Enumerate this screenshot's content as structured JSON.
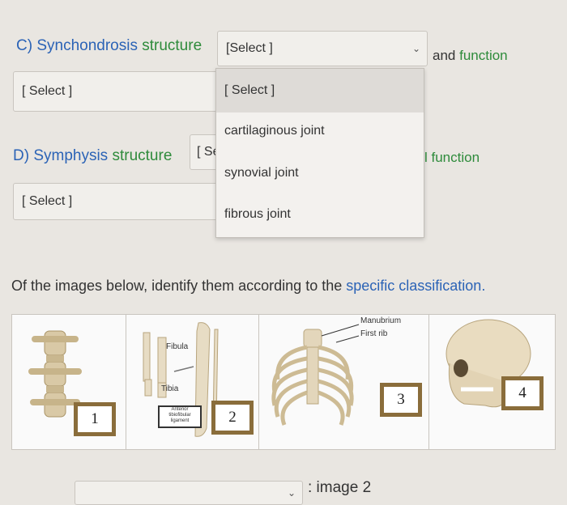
{
  "questions": {
    "c": {
      "label": "C) Synchondrosis structure",
      "dropdown_value": "[Select ]",
      "and_function": "and function",
      "function_select": "[ Select ]"
    },
    "d": {
      "label": "D) Symphysis structure",
      "dropdown_value": "[ Se",
      "function_partial": "l function",
      "function_select": "[ Select ]"
    }
  },
  "dropdown_menu": {
    "options": [
      "[ Select ]",
      "cartilaginous joint",
      "synovial joint",
      "fibrous joint"
    ],
    "highlighted_index": 0
  },
  "instruction": {
    "text": "Of the images below, identify them according to the",
    "highlight": "specific classification."
  },
  "images": {
    "labels": {
      "fibula": "Fibula",
      "tibia": "Tibia",
      "ligament": "Anterior tibiofibular ligament",
      "manubrium": "Manubrium",
      "first_rib": "First rib"
    },
    "numbers": [
      "1",
      "2",
      "3",
      "4"
    ]
  },
  "answer": {
    "suffix": ": image 2"
  },
  "colors": {
    "structure_term": "#2e8b3b",
    "accent_blue": "#2b63b6",
    "number_frame": "#8a6d3b"
  }
}
